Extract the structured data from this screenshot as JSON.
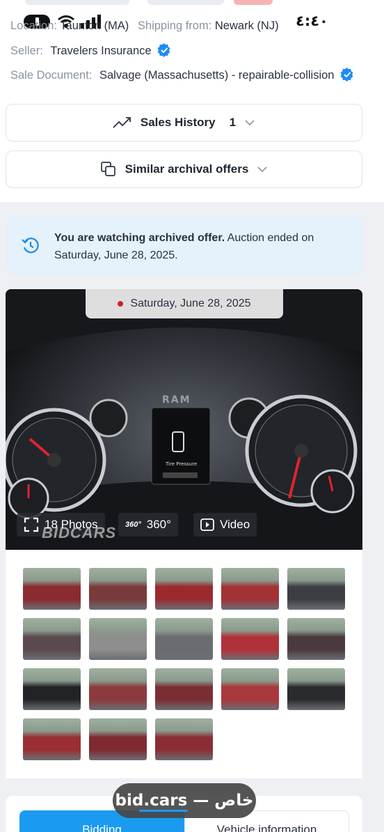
{
  "status_bar": {
    "time": "٤:٤٠"
  },
  "listing": {
    "location_label": "Location:",
    "location_value": "Taunton (MA)",
    "shipping_label": "Shipping from:",
    "shipping_value": "Newark (NJ)",
    "seller_label": "Seller:",
    "seller_value": "Travelers Insurance",
    "sale_doc_label": "Sale Document:",
    "sale_doc_value": "Salvage (Massachusetts) - repairable-collision"
  },
  "sales_history": {
    "label": "Sales History",
    "count": "1"
  },
  "similar_offers": {
    "label": "Similar archival offers"
  },
  "notice": {
    "bold": "You are watching archived offer.",
    "text": " Auction ended on Saturday, June 28, 2025."
  },
  "photo": {
    "date": "Saturday, June 28, 2025",
    "photos_label": "18 Photos",
    "three60_label": "360°",
    "video_label": "Video",
    "watermark": "BIDCARS"
  },
  "gallery": {
    "thumbnails": [
      {
        "color": "#8a2b30"
      },
      {
        "color": "#7a3a3c"
      },
      {
        "color": "#9a2a2e"
      },
      {
        "color": "#a23236"
      },
      {
        "color": "#3c3e44"
      },
      {
        "color": "#5a4a50"
      },
      {
        "color": "#8e8e8e"
      },
      {
        "color": "#6a6c72"
      },
      {
        "color": "#b03238"
      },
      {
        "color": "#4a3a3e"
      },
      {
        "color": "#222326"
      },
      {
        "color": "#8c3a3e"
      },
      {
        "color": "#7a2e32"
      },
      {
        "color": "#a8383c"
      },
      {
        "color": "#2a2b2e"
      },
      {
        "color": "#9a3034"
      },
      {
        "color": "#7e2a30"
      },
      {
        "color": "#8a2e34"
      }
    ]
  },
  "tabs": {
    "bidding": "Bidding",
    "vehicle_info": "Vehicle information"
  },
  "url_bar": {
    "text": "bid.cars — خاص"
  },
  "colors": {
    "accent": "#1a9bf0",
    "verified": "#1d8cf8",
    "live_dot": "#d21f2b"
  }
}
